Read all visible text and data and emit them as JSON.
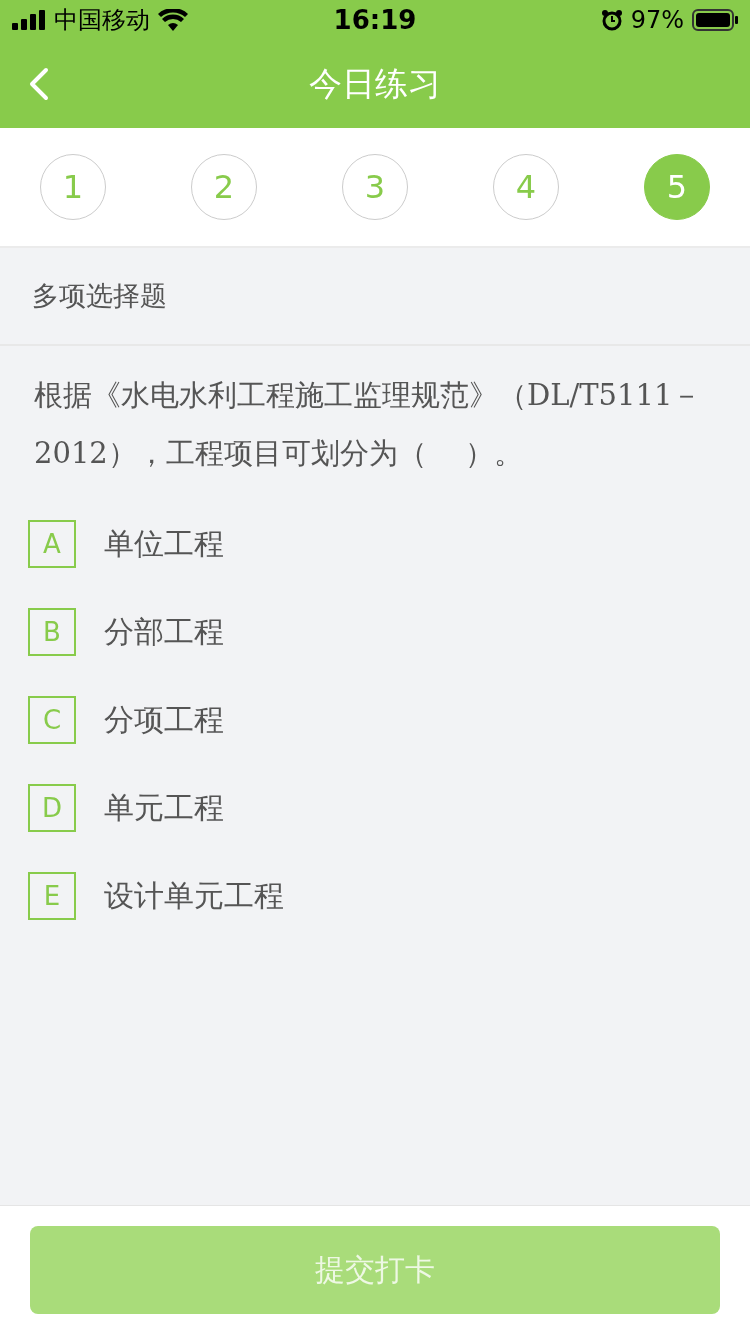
{
  "status_bar": {
    "carrier": "中国移动",
    "time": "16:19",
    "battery": "97%"
  },
  "nav": {
    "title": "今日练习"
  },
  "steps": [
    {
      "label": "1",
      "selected": false
    },
    {
      "label": "2",
      "selected": false
    },
    {
      "label": "3",
      "selected": false
    },
    {
      "label": "4",
      "selected": false
    },
    {
      "label": "5",
      "selected": true
    }
  ],
  "question": {
    "type_label": "多项选择题",
    "text": "根据《水电水利工程施工监理规范》（DL/T5111－2012），工程项目可划分为（　 ）。",
    "options": [
      {
        "letter": "A",
        "text": "单位工程",
        "checked": false
      },
      {
        "letter": "B",
        "text": "分部工程",
        "checked": false
      },
      {
        "letter": "C",
        "text": "分项工程",
        "checked": false
      },
      {
        "letter": "D",
        "text": "单元工程",
        "checked": false
      },
      {
        "letter": "E",
        "text": "设计单元工程",
        "checked": false
      }
    ]
  },
  "submit": {
    "label": "提交打卡",
    "disabled": true
  }
}
